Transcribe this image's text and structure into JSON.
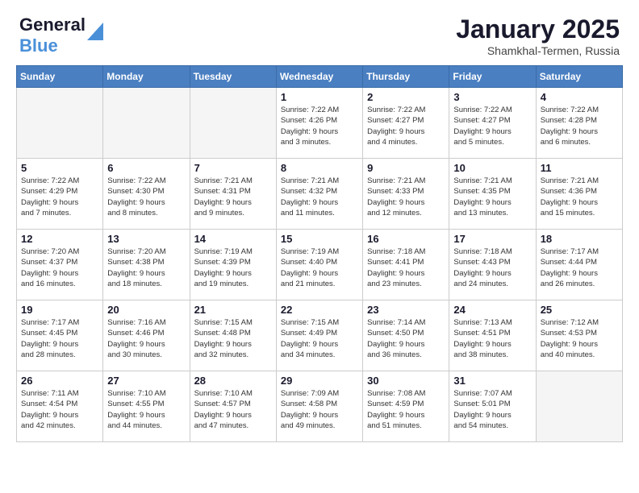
{
  "header": {
    "logo_text_general": "General",
    "logo_text_blue": "Blue",
    "title": "January 2025",
    "subtitle": "Shamkhal-Termen, Russia"
  },
  "weekdays": [
    "Sunday",
    "Monday",
    "Tuesday",
    "Wednesday",
    "Thursday",
    "Friday",
    "Saturday"
  ],
  "weeks": [
    [
      {
        "day": "",
        "info": ""
      },
      {
        "day": "",
        "info": ""
      },
      {
        "day": "",
        "info": ""
      },
      {
        "day": "1",
        "info": "Sunrise: 7:22 AM\nSunset: 4:26 PM\nDaylight: 9 hours\nand 3 minutes."
      },
      {
        "day": "2",
        "info": "Sunrise: 7:22 AM\nSunset: 4:27 PM\nDaylight: 9 hours\nand 4 minutes."
      },
      {
        "day": "3",
        "info": "Sunrise: 7:22 AM\nSunset: 4:27 PM\nDaylight: 9 hours\nand 5 minutes."
      },
      {
        "day": "4",
        "info": "Sunrise: 7:22 AM\nSunset: 4:28 PM\nDaylight: 9 hours\nand 6 minutes."
      }
    ],
    [
      {
        "day": "5",
        "info": "Sunrise: 7:22 AM\nSunset: 4:29 PM\nDaylight: 9 hours\nand 7 minutes."
      },
      {
        "day": "6",
        "info": "Sunrise: 7:22 AM\nSunset: 4:30 PM\nDaylight: 9 hours\nand 8 minutes."
      },
      {
        "day": "7",
        "info": "Sunrise: 7:21 AM\nSunset: 4:31 PM\nDaylight: 9 hours\nand 9 minutes."
      },
      {
        "day": "8",
        "info": "Sunrise: 7:21 AM\nSunset: 4:32 PM\nDaylight: 9 hours\nand 11 minutes."
      },
      {
        "day": "9",
        "info": "Sunrise: 7:21 AM\nSunset: 4:33 PM\nDaylight: 9 hours\nand 12 minutes."
      },
      {
        "day": "10",
        "info": "Sunrise: 7:21 AM\nSunset: 4:35 PM\nDaylight: 9 hours\nand 13 minutes."
      },
      {
        "day": "11",
        "info": "Sunrise: 7:21 AM\nSunset: 4:36 PM\nDaylight: 9 hours\nand 15 minutes."
      }
    ],
    [
      {
        "day": "12",
        "info": "Sunrise: 7:20 AM\nSunset: 4:37 PM\nDaylight: 9 hours\nand 16 minutes."
      },
      {
        "day": "13",
        "info": "Sunrise: 7:20 AM\nSunset: 4:38 PM\nDaylight: 9 hours\nand 18 minutes."
      },
      {
        "day": "14",
        "info": "Sunrise: 7:19 AM\nSunset: 4:39 PM\nDaylight: 9 hours\nand 19 minutes."
      },
      {
        "day": "15",
        "info": "Sunrise: 7:19 AM\nSunset: 4:40 PM\nDaylight: 9 hours\nand 21 minutes."
      },
      {
        "day": "16",
        "info": "Sunrise: 7:18 AM\nSunset: 4:41 PM\nDaylight: 9 hours\nand 23 minutes."
      },
      {
        "day": "17",
        "info": "Sunrise: 7:18 AM\nSunset: 4:43 PM\nDaylight: 9 hours\nand 24 minutes."
      },
      {
        "day": "18",
        "info": "Sunrise: 7:17 AM\nSunset: 4:44 PM\nDaylight: 9 hours\nand 26 minutes."
      }
    ],
    [
      {
        "day": "19",
        "info": "Sunrise: 7:17 AM\nSunset: 4:45 PM\nDaylight: 9 hours\nand 28 minutes."
      },
      {
        "day": "20",
        "info": "Sunrise: 7:16 AM\nSunset: 4:46 PM\nDaylight: 9 hours\nand 30 minutes."
      },
      {
        "day": "21",
        "info": "Sunrise: 7:15 AM\nSunset: 4:48 PM\nDaylight: 9 hours\nand 32 minutes."
      },
      {
        "day": "22",
        "info": "Sunrise: 7:15 AM\nSunset: 4:49 PM\nDaylight: 9 hours\nand 34 minutes."
      },
      {
        "day": "23",
        "info": "Sunrise: 7:14 AM\nSunset: 4:50 PM\nDaylight: 9 hours\nand 36 minutes."
      },
      {
        "day": "24",
        "info": "Sunrise: 7:13 AM\nSunset: 4:51 PM\nDaylight: 9 hours\nand 38 minutes."
      },
      {
        "day": "25",
        "info": "Sunrise: 7:12 AM\nSunset: 4:53 PM\nDaylight: 9 hours\nand 40 minutes."
      }
    ],
    [
      {
        "day": "26",
        "info": "Sunrise: 7:11 AM\nSunset: 4:54 PM\nDaylight: 9 hours\nand 42 minutes."
      },
      {
        "day": "27",
        "info": "Sunrise: 7:10 AM\nSunset: 4:55 PM\nDaylight: 9 hours\nand 44 minutes."
      },
      {
        "day": "28",
        "info": "Sunrise: 7:10 AM\nSunset: 4:57 PM\nDaylight: 9 hours\nand 47 minutes."
      },
      {
        "day": "29",
        "info": "Sunrise: 7:09 AM\nSunset: 4:58 PM\nDaylight: 9 hours\nand 49 minutes."
      },
      {
        "day": "30",
        "info": "Sunrise: 7:08 AM\nSunset: 4:59 PM\nDaylight: 9 hours\nand 51 minutes."
      },
      {
        "day": "31",
        "info": "Sunrise: 7:07 AM\nSunset: 5:01 PM\nDaylight: 9 hours\nand 54 minutes."
      },
      {
        "day": "",
        "info": ""
      }
    ]
  ]
}
